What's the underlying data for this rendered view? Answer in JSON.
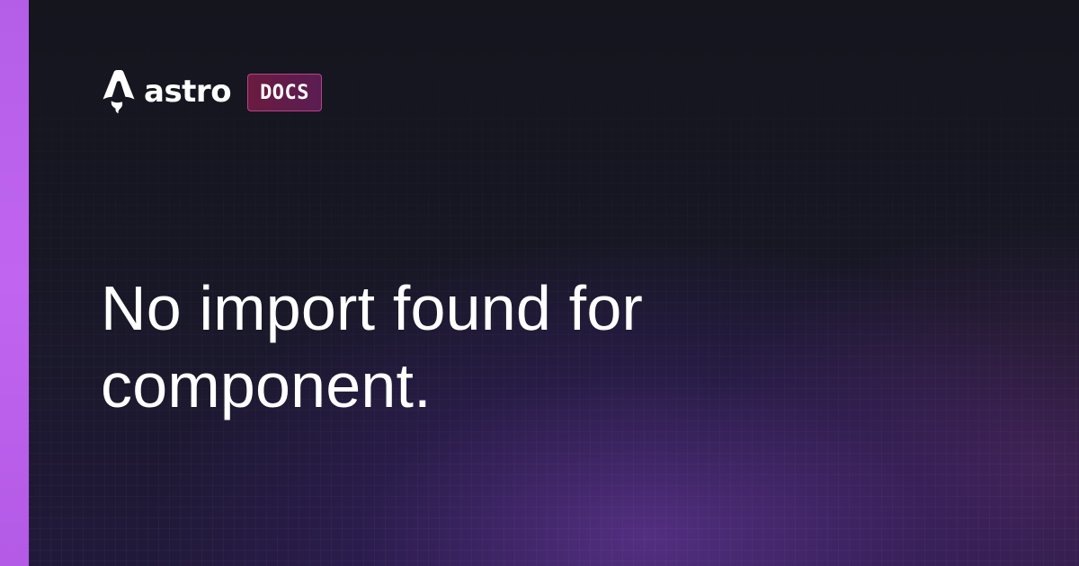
{
  "brand": {
    "logo_icon": "astro-rocket-icon",
    "name": "astro",
    "badge": "DOCS"
  },
  "page": {
    "title": "No import found for component."
  },
  "colors": {
    "accent_bar": "#c065ef",
    "background": "#15161f",
    "badge_border": "#b4458a",
    "badge_fill": "#6a1b3f",
    "text": "#ffffff"
  }
}
